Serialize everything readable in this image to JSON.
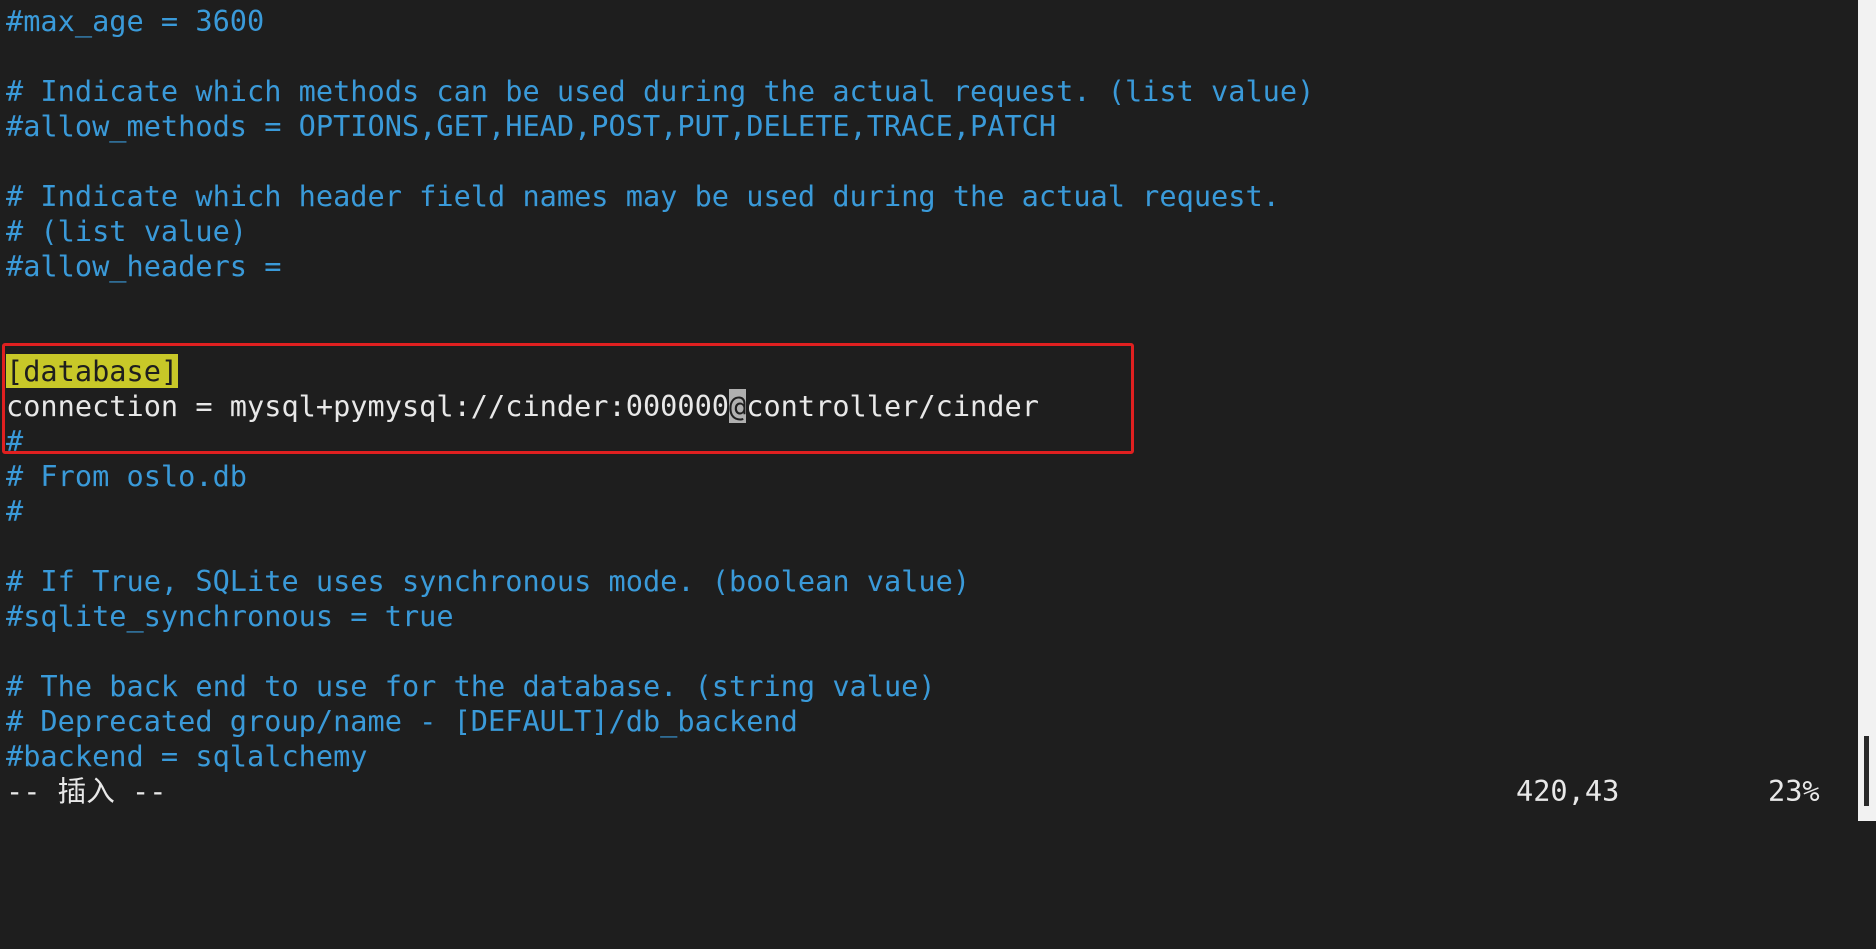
{
  "editor": {
    "lines": [
      {
        "type": "comment",
        "text": "#max_age = 3600"
      },
      {
        "type": "blank",
        "text": ""
      },
      {
        "type": "comment",
        "text": "# Indicate which methods can be used during the actual request. (list value)"
      },
      {
        "type": "comment",
        "text": "#allow_methods = OPTIONS,GET,HEAD,POST,PUT,DELETE,TRACE,PATCH"
      },
      {
        "type": "blank",
        "text": ""
      },
      {
        "type": "comment",
        "text": "# Indicate which header field names may be used during the actual request."
      },
      {
        "type": "comment",
        "text": "# (list value)"
      },
      {
        "type": "comment",
        "text": "#allow_headers ="
      },
      {
        "type": "blank",
        "text": ""
      },
      {
        "type": "blank",
        "text": ""
      },
      {
        "type": "section",
        "text": "[database]"
      },
      {
        "type": "cursor-line",
        "before": "connection = mysql+pymysql://cinder:000000",
        "cursor": "@",
        "after": "controller/cinder"
      },
      {
        "type": "comment",
        "text": "#"
      },
      {
        "type": "comment",
        "text": "# From oslo.db"
      },
      {
        "type": "comment",
        "text": "#"
      },
      {
        "type": "blank",
        "text": ""
      },
      {
        "type": "comment",
        "text": "# If True, SQLite uses synchronous mode. (boolean value)"
      },
      {
        "type": "comment",
        "text": "#sqlite_synchronous = true"
      },
      {
        "type": "blank",
        "text": ""
      },
      {
        "type": "comment",
        "text": "# The back end to use for the database. (string value)"
      },
      {
        "type": "comment",
        "text": "# Deprecated group/name - [DEFAULT]/db_backend"
      },
      {
        "type": "comment",
        "text": "#backend = sqlalchemy"
      }
    ]
  },
  "status": {
    "mode": "-- 插入 --",
    "position": "420,43",
    "percent": "23%"
  },
  "colors": {
    "background": "#1e1e1e",
    "comment": "#3a9ad9",
    "normal": "#e8e8e8",
    "section_highlight": "#c8c828",
    "annotation_box": "#e02020"
  }
}
